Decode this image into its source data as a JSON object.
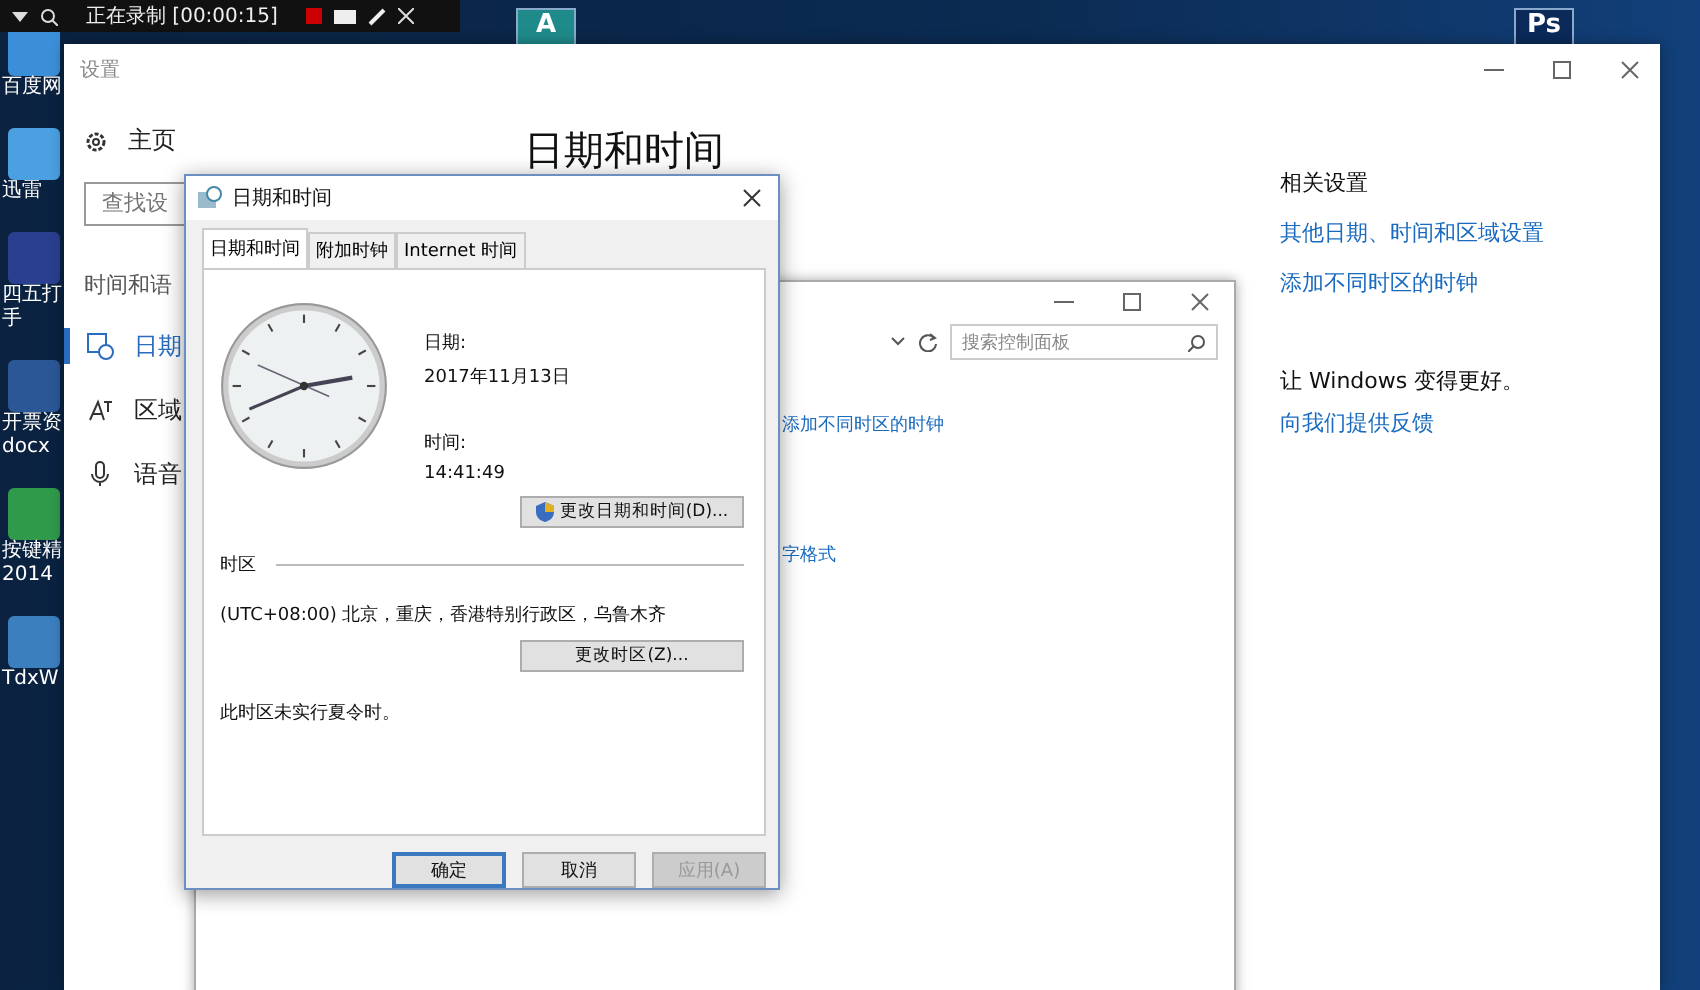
{
  "recorder_bar": {
    "status": "正在录制 [00:00:15]"
  },
  "desktop_icons": [
    {
      "lines": [
        "百度网"
      ],
      "color": "#3a8fd8"
    },
    {
      "lines": [
        "迅雷"
      ],
      "color": "#4aa0e0"
    },
    {
      "lines": [
        "四五打",
        "手"
      ],
      "color": "#2a3f8f"
    },
    {
      "lines": [
        "开票资",
        "docx"
      ],
      "color": "#2b5797"
    },
    {
      "lines": [
        "按键精",
        "2014"
      ],
      "color": "#2e9a4a"
    },
    {
      "lines": [
        "TdxW"
      ],
      "color": "#3c7fbf"
    }
  ],
  "top_icons": [
    {
      "label": "A",
      "color": "#1f8a8a"
    },
    {
      "label": "Ps",
      "color": "#0b2a5a"
    }
  ],
  "settings_window": {
    "title": "设置",
    "sidebar": {
      "home": "主页",
      "search": {
        "placeholder": "查找设"
      },
      "section": "时间和语",
      "items": [
        {
          "label": "日期",
          "kind": "clock",
          "selected": true
        },
        {
          "label": "区域",
          "kind": "region",
          "selected": false
        },
        {
          "label": "语音",
          "kind": "mic",
          "selected": false
        }
      ]
    },
    "heading": "日期和时间",
    "related": {
      "title": "相关设置",
      "links": [
        "其他日期、时间和区域设置",
        "添加不同时区的时钟"
      ]
    },
    "feedback": {
      "title": "让 Windows 变得更好。",
      "link": "向我们提供反馈"
    }
  },
  "control_panel_window": {
    "search": {
      "placeholder": "搜索控制面板"
    },
    "links": [
      "添加不同时区的时钟",
      "字格式"
    ]
  },
  "dialog": {
    "title": "日期和时间",
    "tabs": [
      {
        "label": "日期和时间",
        "selected": true
      },
      {
        "label": "附加时钟",
        "selected": false
      },
      {
        "label": "Internet 时间",
        "selected": false
      }
    ],
    "date_label": "日期:",
    "date": "2017年11月13日",
    "time_label": "时间:",
    "time": "14:41:49",
    "change_datetime_button": "更改日期和时间(D)...",
    "timezone_group": "时区",
    "timezone": "(UTC+08:00) 北京，重庆，香港特别行政区，乌鲁木齐",
    "change_timezone_button": "更改时区(Z)...",
    "dst_note": "此时区未实行夏令时。",
    "buttons": [
      {
        "label": "确定",
        "kind": "default",
        "disabled": false
      },
      {
        "label": "取消",
        "kind": "normal",
        "disabled": false
      },
      {
        "label": "应用(A)",
        "kind": "normal",
        "disabled": true
      }
    ]
  }
}
